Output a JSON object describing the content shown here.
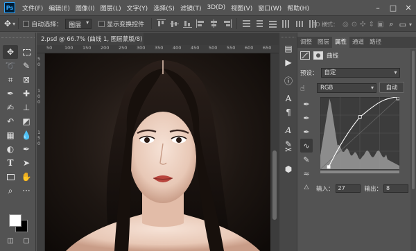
{
  "app": {
    "logo": "Ps"
  },
  "menu": [
    "文件(F)",
    "编辑(E)",
    "图像(I)",
    "图层(L)",
    "文字(Y)",
    "选择(S)",
    "滤镜(T)",
    "3D(D)",
    "视图(V)",
    "窗口(W)",
    "帮助(H)"
  ],
  "window_controls": {
    "minimize": "–",
    "maximize": "□",
    "close": "✕"
  },
  "options_bar": {
    "auto_select_label": "自动选择：",
    "auto_select_value": "图层",
    "show_transform_label": "显示变换控件",
    "mode_3d_label": "3D 模式："
  },
  "document": {
    "tab_title": "2.psd @ 66.7% (曲线 1, 图层蒙版/8) *",
    "close": "×",
    "ruler_h": [
      "50",
      "100",
      "150",
      "200",
      "250",
      "300",
      "350",
      "400",
      "450",
      "500",
      "550",
      "600",
      "650"
    ],
    "ruler_v": [
      "5",
      "0",
      "1",
      "0",
      "0",
      "1",
      "5",
      "0"
    ]
  },
  "properties": {
    "tabs": [
      "调整",
      "图层",
      "属性",
      "通道",
      "路径"
    ],
    "active_tab": "属性",
    "title": "曲线",
    "preset_label": "预设：",
    "preset_value": "自定",
    "channel_value": "RGB",
    "auto_button": "自动",
    "input_label": "输入：",
    "input_value": "27",
    "output_label": "输出：",
    "output_value": "8"
  },
  "curve": {
    "points": [
      [
        27,
        8
      ],
      [
        128,
        185
      ],
      [
        255,
        255
      ]
    ],
    "range": [
      0,
      255
    ],
    "histogram_color": "#9a9a9a",
    "curve_color": "#ffffff"
  },
  "colors": {
    "foreground": "#ffffff",
    "background": "#000000"
  }
}
